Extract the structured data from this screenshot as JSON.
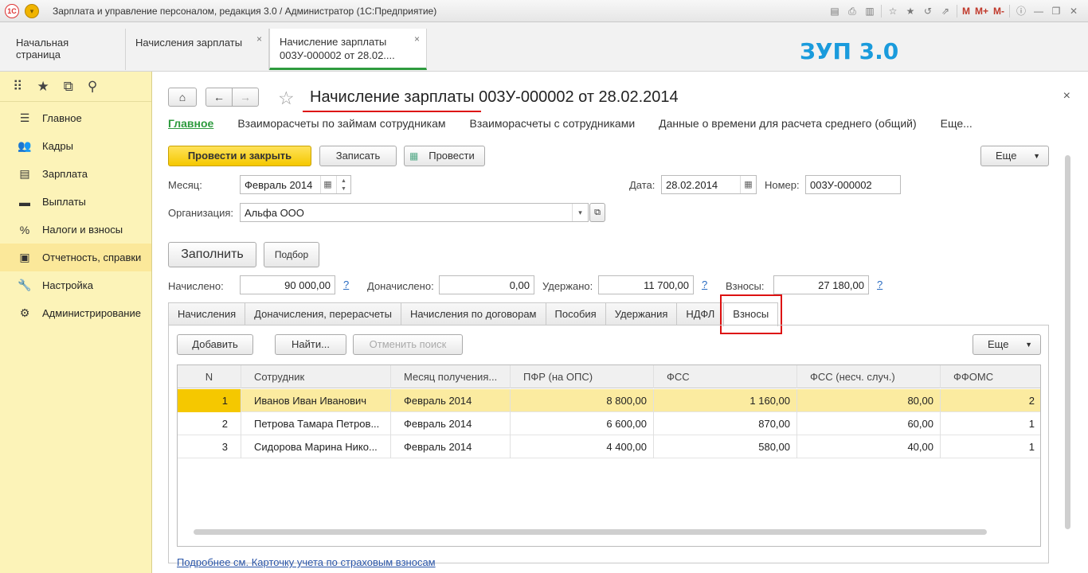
{
  "window": {
    "title": "Зарплата и управление персоналом, редакция 3.0 / Администратор  (1С:Предприятие)",
    "logo": "1С",
    "toolbar_letters": [
      "M",
      "M+",
      "M-"
    ]
  },
  "tabs": [
    {
      "label": "Начальная страница"
    },
    {
      "label": "Начисления зарплаты",
      "close": "×"
    },
    {
      "label_line1": "Начисление зарплаты",
      "label_line2": "003У-000002 от 28.02....",
      "close": "×"
    }
  ],
  "brand_label": "ЗУП 3.0",
  "sidebar": {
    "items": [
      {
        "label": "Главное",
        "icon": "menu-lines-icon"
      },
      {
        "label": "Кадры",
        "icon": "people-icon"
      },
      {
        "label": "Зарплата",
        "icon": "calculator-icon"
      },
      {
        "label": "Выплаты",
        "icon": "wallet-icon"
      },
      {
        "label": "Налоги и взносы",
        "icon": "percent-icon"
      },
      {
        "label": "Отчетность, справки",
        "icon": "report-icon"
      },
      {
        "label": "Настройка",
        "icon": "wrench-icon"
      },
      {
        "label": "Администрирование",
        "icon": "gear-icon"
      }
    ]
  },
  "document": {
    "title": "Начисление зарплаты 003У-000002 от 28.02.2014",
    "sections": [
      "Главное",
      "Взаиморасчеты по займам сотрудникам",
      "Взаиморасчеты с сотрудниками",
      "Данные о времени для расчета среднего (общий)",
      "Еще..."
    ],
    "buttons": {
      "post_close": "Провести и закрыть",
      "save": "Записать",
      "post": "Провести",
      "more": "Еще",
      "fill": "Заполнить",
      "select": "Подбор"
    },
    "month_label": "Месяц:",
    "month_value": "Февраль 2014",
    "date_label": "Дата:",
    "date_value": "28.02.2014",
    "number_label": "Номер:",
    "number_value": "003У-000002",
    "org_label": "Организация:",
    "org_value": "Альфа ООО",
    "totals": {
      "accrued_label": "Начислено:",
      "accrued_value": "90 000,00",
      "additional_label": "Доначислено:",
      "additional_value": "0,00",
      "withheld_label": "Удержано:",
      "withheld_value": "11 700,00",
      "contrib_label": "Взносы:",
      "contrib_value": "27 180,00",
      "help": "?"
    },
    "form_tabs": [
      "Начисления",
      "Доначисления, перерасчеты",
      "Начисления по договорам",
      "Пособия",
      "Удержания",
      "НДФЛ",
      "Взносы"
    ],
    "grid_buttons": {
      "add": "Добавить",
      "find": "Найти...",
      "cancel_search": "Отменить поиск",
      "more": "Еще"
    },
    "grid": {
      "columns": [
        "N",
        "Сотрудник",
        "Месяц получения...",
        "ПФР (на ОПС)",
        "ФСС",
        "ФСС (несч. случ.)",
        "ФФОМС"
      ],
      "rows": [
        [
          "1",
          "Иванов Иван Иванович",
          "Февраль 2014",
          "8 800,00",
          "1 160,00",
          "80,00",
          "2"
        ],
        [
          "2",
          "Петрова Тамара Петров...",
          "Февраль 2014",
          "6 600,00",
          "870,00",
          "60,00",
          "1"
        ],
        [
          "3",
          "Сидорова Марина Нико...",
          "Февраль 2014",
          "4 400,00",
          "580,00",
          "40,00",
          "1"
        ]
      ]
    },
    "bottom_link": "Подробнее см. Карточку учета по страховым взносам"
  },
  "colors": {
    "accent_green": "#2e9b3e",
    "sidebar_bg": "#fcf3b8",
    "primary_button": "#f5c800",
    "brand_blue": "#1a9bdc",
    "highlight_red": "#d11"
  }
}
